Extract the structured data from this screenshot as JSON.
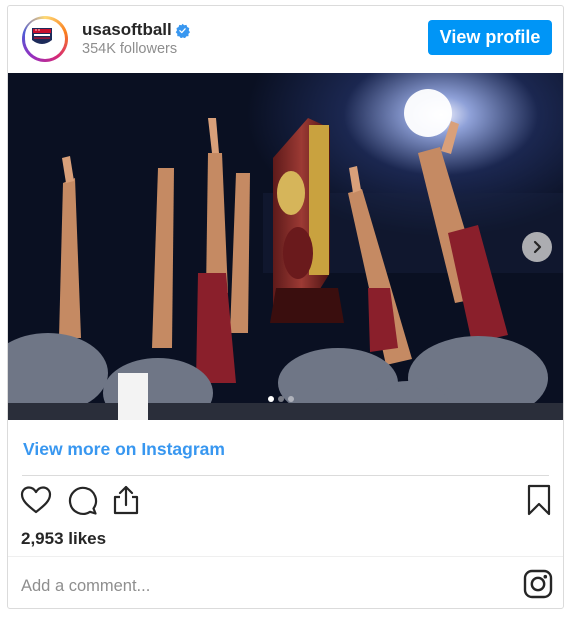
{
  "header": {
    "username": "usasoftball",
    "followers": "354K followers",
    "view_profile_label": "View profile",
    "verified_color": "#3897f0"
  },
  "post": {
    "image_description_icon": "team-raising-trophy-photo",
    "carousel_dots": 3,
    "active_dot": 0
  },
  "links": {
    "view_more": "View more on Instagram"
  },
  "stats": {
    "likes": "2,953 likes"
  },
  "comment": {
    "placeholder": "Add a comment..."
  },
  "colors": {
    "accent": "#0095f6",
    "link": "#3897f0"
  }
}
